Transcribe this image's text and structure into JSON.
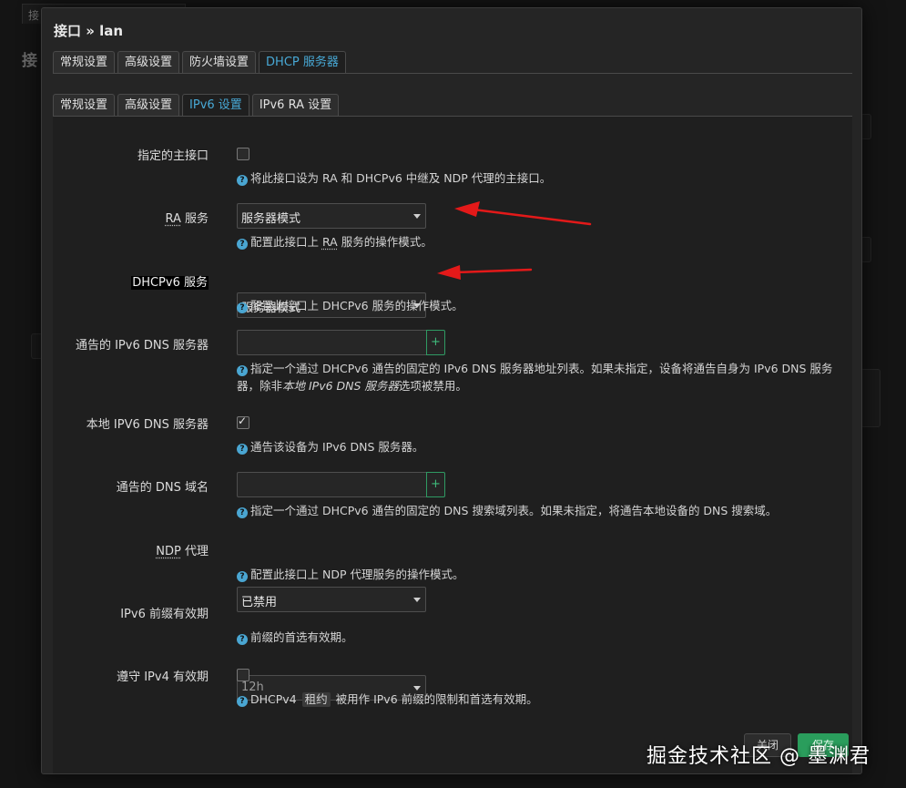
{
  "background": {
    "tab_label": "接",
    "heading": "接"
  },
  "modal": {
    "title": "接口 » lan",
    "outer_tabs": [
      {
        "label": "常规设置",
        "active": false
      },
      {
        "label": "高级设置",
        "active": false
      },
      {
        "label": "防火墙设置",
        "active": false
      },
      {
        "label": "DHCP 服务器",
        "active": true
      }
    ],
    "inner_tabs": [
      {
        "label": "常规设置",
        "active": false
      },
      {
        "label": "高级设置",
        "active": false
      },
      {
        "label": "IPv6 设置",
        "active": true
      },
      {
        "label": "IPv6 RA 设置",
        "active": false
      }
    ],
    "fields": {
      "master": {
        "label": "指定的主接口",
        "checked": false,
        "help": "将此接口设为 RA 和 DHCPv6 中继及 NDP 代理的主接口。"
      },
      "ra_service": {
        "label_abbr": "RA",
        "label_rest": " 服务",
        "value": "服务器模式",
        "help_pre": "配置此接口上 ",
        "help_abbr": "RA",
        "help_post": " 服务的操作模式。"
      },
      "dhcpv6_service": {
        "label": "DHCPv6 服务",
        "value": "服务器模式",
        "help": "配置此接口上 DHCPv6 服务的操作模式。"
      },
      "announced_dns": {
        "label": "通告的 IPv6 DNS 服务器",
        "value": "",
        "help_pre": "指定一个通过 DHCPv6 通告的固定的 IPv6 DNS 服务器地址列表。如果未指定，设备将通告自身为 IPv6 DNS 服务器，除非",
        "help_em": "本地 IPv6 DNS 服务器",
        "help_post": "选项被禁用。"
      },
      "local_dns": {
        "label": "本地 IPV6 DNS 服务器",
        "checked": true,
        "help": "通告该设备为 IPv6 DNS 服务器。"
      },
      "dns_domains": {
        "label": "通告的 DNS 域名",
        "value": "",
        "help": "指定一个通过 DHCPv6 通告的固定的 DNS 搜索域列表。如果未指定，将通告本地设备的 DNS 搜索域。"
      },
      "ndp_proxy": {
        "label_abbr": "NDP",
        "label_rest": " 代理",
        "value": "已禁用",
        "help": "配置此接口上 NDP 代理服务的操作模式。"
      },
      "prefix_lifetime": {
        "label": "IPv6 前缀有效期",
        "value": "12h",
        "help": "前缀的首选有效期。"
      },
      "ipv4_lifetime": {
        "label": "遵守 IPv4 有效期",
        "checked": false,
        "help_pre": "DHCPv4 ",
        "help_badge": "租约",
        "help_post": " 被用作 IPv6 前缀的限制和首选有效期。"
      }
    },
    "plus_label": "+",
    "help_icon": "?",
    "buttons": {
      "close": "关闭",
      "save": "保存"
    }
  },
  "watermark": "掘金技术社区 @ 墨渊君",
  "colors": {
    "accent_tab": "#48a9d6",
    "save_button": "#2a9d5c",
    "help_icon": "#4aa6d2",
    "arrow": "#e31919"
  }
}
